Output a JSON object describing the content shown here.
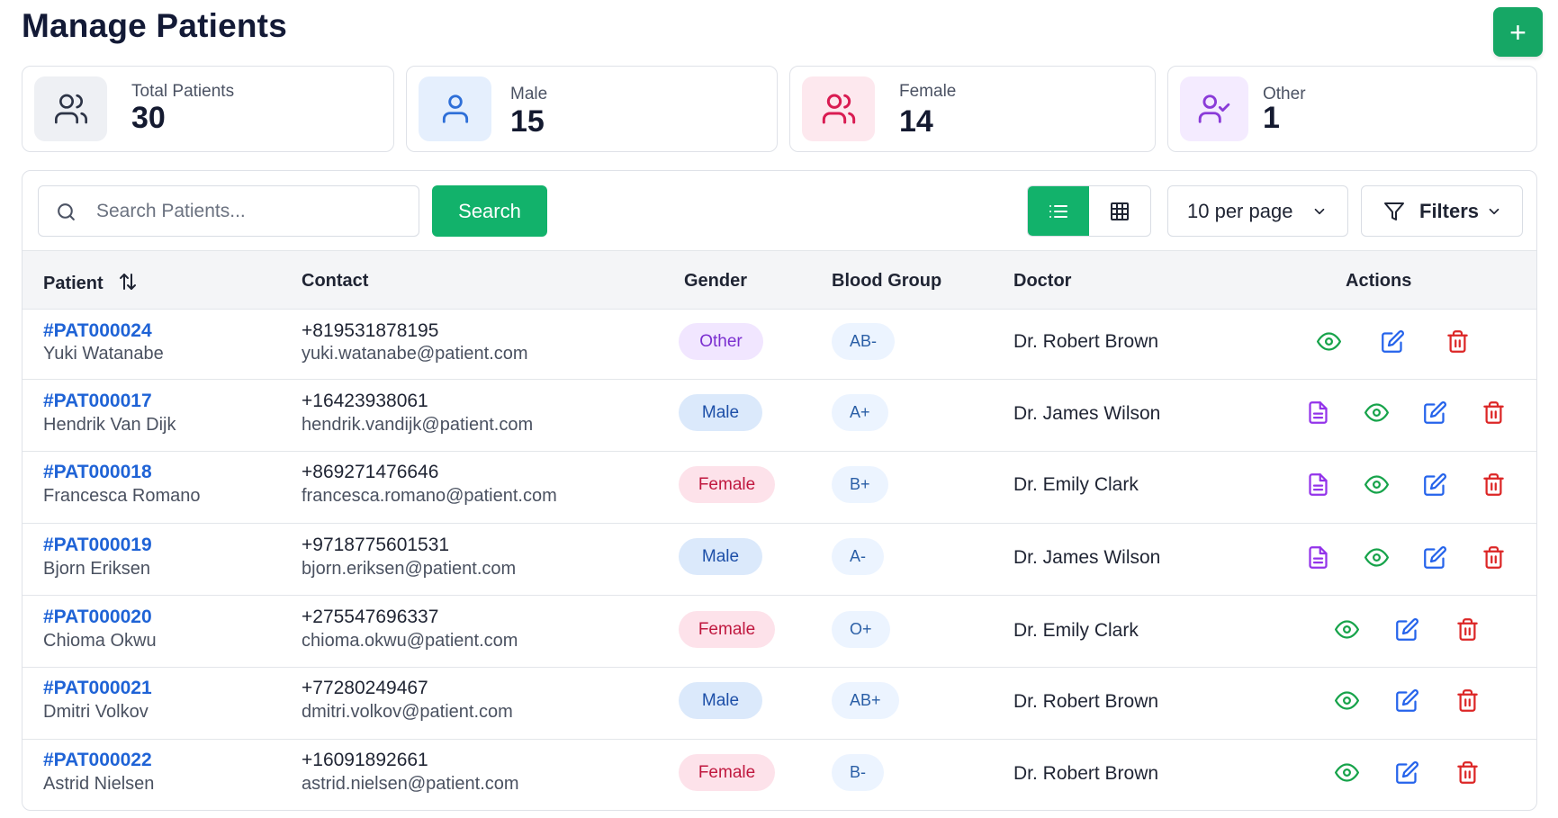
{
  "page": {
    "title": "Manage Patients",
    "add_symbol": "+"
  },
  "stats": [
    {
      "label": "Total Patients",
      "value": "30",
      "icon": "users-icon",
      "icon_bg": "#eef0f4",
      "icon_color": "#2d3446"
    },
    {
      "label": "Male",
      "value": "15",
      "icon": "user-icon",
      "icon_bg": "#e5effd",
      "icon_color": "#2e6fd8"
    },
    {
      "label": "Female",
      "value": "14",
      "icon": "users-icon",
      "icon_bg": "#fde8ee",
      "icon_color": "#d91c52"
    },
    {
      "label": "Other",
      "value": "1",
      "icon": "user-check-icon",
      "icon_bg": "#f4ebff",
      "icon_color": "#8a3bd8"
    }
  ],
  "toolbar": {
    "search_placeholder": "Search Patients...",
    "search_label": "Search",
    "per_page": "10 per page",
    "filters_label": "Filters",
    "active_view": "list"
  },
  "table": {
    "headers": {
      "patient": "Patient",
      "contact": "Contact",
      "gender": "Gender",
      "blood": "Blood Group",
      "doctor": "Doctor",
      "actions": "Actions"
    },
    "rows": [
      {
        "id": "#PAT000024",
        "name": "Yuki Watanabe",
        "phone": "+819531878195",
        "email": "yuki.watanabe@patient.com",
        "gender": "Other",
        "blood": "AB-",
        "doctor": "Dr. Robert Brown",
        "has_record": false
      },
      {
        "id": "#PAT000017",
        "name": "Hendrik Van Dijk",
        "phone": "+16423938061",
        "email": "hendrik.vandijk@patient.com",
        "gender": "Male",
        "blood": "A+",
        "doctor": "Dr. James Wilson",
        "has_record": true
      },
      {
        "id": "#PAT000018",
        "name": "Francesca Romano",
        "phone": "+869271476646",
        "email": "francesca.romano@patient.com",
        "gender": "Female",
        "blood": "B+",
        "doctor": "Dr. Emily Clark",
        "has_record": true
      },
      {
        "id": "#PAT000019",
        "name": "Bjorn Eriksen",
        "phone": "+9718775601531",
        "email": "bjorn.eriksen@patient.com",
        "gender": "Male",
        "blood": "A-",
        "doctor": "Dr. James Wilson",
        "has_record": true
      },
      {
        "id": "#PAT000020",
        "name": "Chioma Okwu",
        "phone": "+275547696337",
        "email": "chioma.okwu@patient.com",
        "gender": "Female",
        "blood": "O+",
        "doctor": "Dr. Emily Clark",
        "has_record": false
      },
      {
        "id": "#PAT000021",
        "name": "Dmitri Volkov",
        "phone": "+77280249467",
        "email": "dmitri.volkov@patient.com",
        "gender": "Male",
        "blood": "AB+",
        "doctor": "Dr. Robert Brown",
        "has_record": false
      },
      {
        "id": "#PAT000022",
        "name": "Astrid Nielsen",
        "phone": "+16091892661",
        "email": "astrid.nielsen@patient.com",
        "gender": "Female",
        "blood": "B-",
        "doctor": "Dr. Robert Brown",
        "has_record": false
      }
    ]
  },
  "colors": {
    "accent": "#12b26b",
    "link": "#1f63d6",
    "view": "#16a34a",
    "edit": "#2563eb",
    "delete": "#dc2626",
    "record": "#9333ea"
  }
}
